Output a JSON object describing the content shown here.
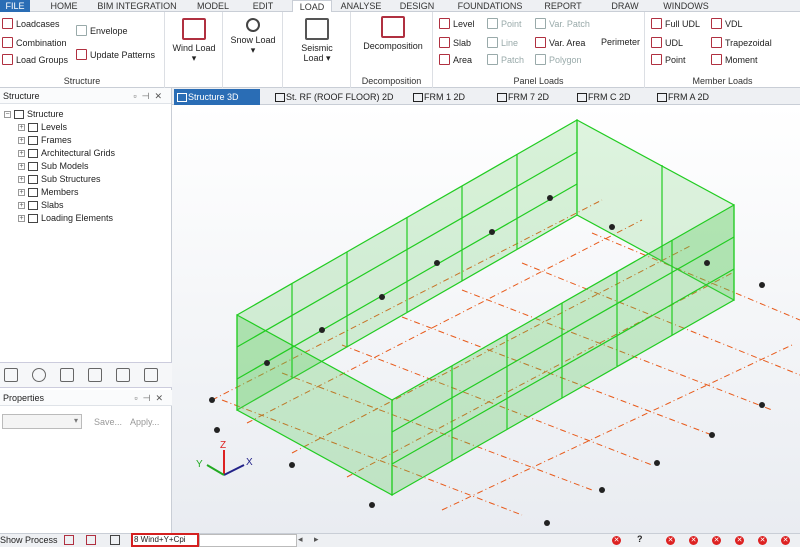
{
  "menu_tabs": [
    "FILE",
    "HOME",
    "BIM INTEGRATION",
    "MODEL",
    "EDIT",
    "LOAD",
    "ANALYSE",
    "DESIGN",
    "FOUNDATIONS",
    "REPORT",
    "DRAW",
    "WINDOWS"
  ],
  "ribbon": {
    "structure": {
      "loadcases": "Loadcases",
      "combination": "Combination",
      "load_groups": "Load Groups",
      "envelope": "Envelope",
      "update_patterns": "Update Patterns",
      "label": "Structure"
    },
    "wind_load": "Wind Load",
    "snow_load": "Snow Load",
    "seismic_load_1": "Seismic",
    "seismic_load_2": "Load",
    "decomposition": {
      "button": "Decomposition",
      "label": "Decomposition"
    },
    "panel": {
      "level": "Level",
      "slab": "Slab",
      "area": "Area",
      "point": "Point",
      "line": "Line",
      "patch": "Patch",
      "var_patch": "Var. Patch",
      "var_area": "Var. Area",
      "polygon": "Polygon",
      "perimeter": "Perimeter",
      "label": "Panel Loads"
    },
    "member": {
      "full_udl": "Full UDL",
      "udl": "UDL",
      "point": "Point",
      "vdl": "VDL",
      "trapezoidal": "Trapezoidal",
      "moment": "Moment",
      "label": "Member Loads"
    }
  },
  "structure_panel": {
    "title": "Structure",
    "root": "Structure",
    "items": [
      "Levels",
      "Frames",
      "Architectural Grids",
      "Sub Models",
      "Sub Structures",
      "Members",
      "Slabs",
      "Loading Elements"
    ]
  },
  "properties_panel": {
    "title": "Properties",
    "save": "Save...",
    "apply": "Apply..."
  },
  "view_tabs": [
    "Structure 3D",
    "St. RF (ROOF FLOOR) 2D",
    "FRM 1 2D",
    "FRM 7 2D",
    "FRM C 2D",
    "FRM A 2D"
  ],
  "axes": {
    "z": "Z",
    "y": "Y",
    "x": "X"
  },
  "status": {
    "show_process": "Show Process",
    "loadcase": "8 Wind+Y+Cpi",
    "help": "?"
  },
  "colors": {
    "accent": "#2a6db5",
    "wall": "#33dd33",
    "grid": "#e85a1a"
  }
}
